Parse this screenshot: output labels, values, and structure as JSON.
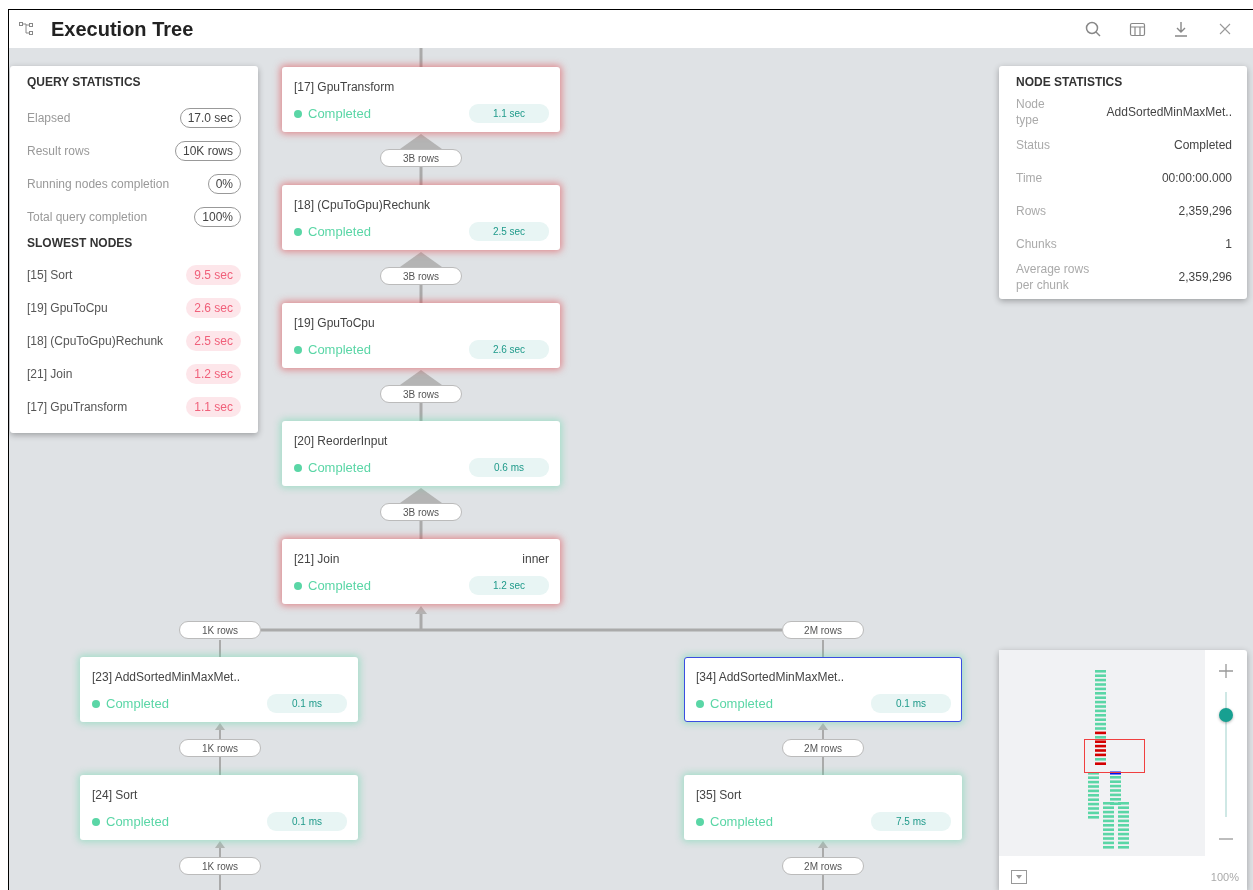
{
  "header": {
    "title": "Execution Tree"
  },
  "query_statistics": {
    "title": "QUERY STATISTICS",
    "rows": [
      {
        "label": "Elapsed",
        "value": "17.0 sec"
      },
      {
        "label": "Result rows",
        "value": "10K rows"
      },
      {
        "label": "Running nodes completion",
        "value": "0%"
      },
      {
        "label": "Total query completion",
        "value": "100%"
      }
    ],
    "slowest_title": "SLOWEST NODES",
    "slowest": [
      {
        "name": "[15] Sort",
        "time": "9.5 sec"
      },
      {
        "name": "[19] GpuToCpu",
        "time": "2.6 sec"
      },
      {
        "name": "[18] (CpuToGpu)Rechunk",
        "time": "2.5 sec"
      },
      {
        "name": "[21] Join",
        "time": "1.2 sec"
      },
      {
        "name": "[17] GpuTransform",
        "time": "1.1 sec"
      }
    ]
  },
  "node_statistics": {
    "title": "NODE STATISTICS",
    "rows": [
      {
        "label": "Node type",
        "value": "AddSortedMinMaxMet.."
      },
      {
        "label": "Status",
        "value": "Completed"
      },
      {
        "label": "Time",
        "value": "00:00:00.000"
      },
      {
        "label": "Rows",
        "value": "2,359,296"
      },
      {
        "label": "Chunks",
        "value": "1"
      },
      {
        "label": "Average rows per chunk",
        "value": "2,359,296"
      }
    ]
  },
  "tree": {
    "nodes": [
      {
        "label": "[17] GpuTransform",
        "status": "Completed",
        "time": "1.1 sec",
        "slow": true,
        "selected": false
      },
      {
        "label": "[18] (CpuToGpu)Rechunk",
        "status": "Completed",
        "time": "2.5 sec",
        "slow": true,
        "selected": false
      },
      {
        "label": "[19] GpuToCpu",
        "status": "Completed",
        "time": "2.6 sec",
        "slow": true,
        "selected": false
      },
      {
        "label": "[20] ReorderInput",
        "status": "Completed",
        "time": "0.6 ms",
        "slow": false,
        "selected": false
      },
      {
        "label": "[21] Join",
        "detail": "inner",
        "status": "Completed",
        "time": "1.2 sec",
        "slow": true,
        "selected": false
      },
      {
        "label": "[23] AddSortedMinMaxMet..",
        "status": "Completed",
        "time": "0.1 ms",
        "slow": false,
        "selected": false
      },
      {
        "label": "[24] Sort",
        "status": "Completed",
        "time": "0.1 ms",
        "slow": false,
        "selected": false
      },
      {
        "label": "[34] AddSortedMinMaxMet..",
        "status": "Completed",
        "time": "0.1 ms",
        "slow": false,
        "selected": true
      },
      {
        "label": "[35] Sort",
        "status": "Completed",
        "time": "7.5 ms",
        "slow": false,
        "selected": false
      }
    ],
    "edges": [
      {
        "label": "3B rows"
      },
      {
        "label": "3B rows"
      },
      {
        "label": "3B rows"
      },
      {
        "label": "3B rows"
      },
      {
        "label": "1K rows"
      },
      {
        "label": "2M rows"
      },
      {
        "label": "1K rows"
      },
      {
        "label": "1K rows"
      },
      {
        "label": "2M rows"
      },
      {
        "label": "2M rows"
      }
    ]
  },
  "minimap": {
    "zoom": {
      "level": 0.82
    },
    "zoom_label": "100%"
  }
}
